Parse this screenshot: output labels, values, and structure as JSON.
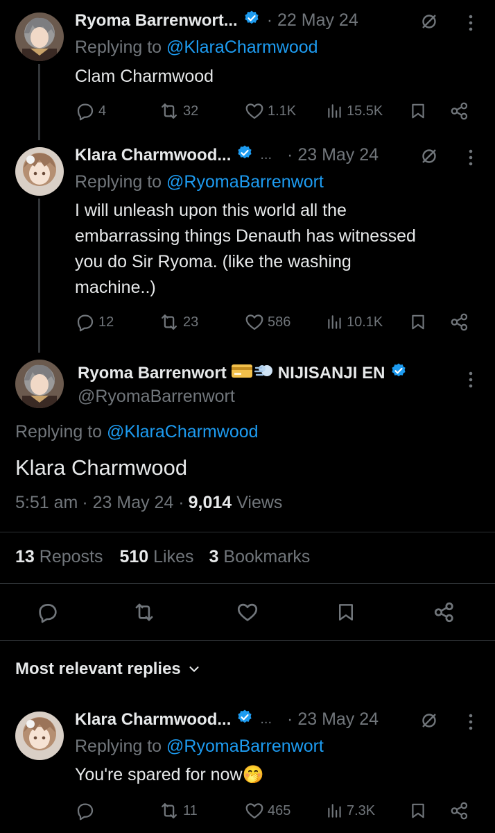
{
  "tweets": [
    {
      "name": "Ryoma Barrenwort...",
      "date": "· 22 May 24",
      "replying_label": "Replying to",
      "replying_handle": "@KlaraCharmwood",
      "text": "Clam Charmwood",
      "replies": "4",
      "reposts": "32",
      "likes": "1.1K",
      "views": "15.5K"
    },
    {
      "name": "Klara Charmwood...",
      "extra": "...",
      "date": "· 23 May 24",
      "replying_label": "Replying to",
      "replying_handle": "@RyomaBarrenwort",
      "text_lines": [
        "I will unleash upon this world all the",
        "embarrassing things Denauth has witnessed",
        "you do Sir Ryoma. (like the washing",
        "machine..)"
      ],
      "replies": "12",
      "reposts": "23",
      "likes": "586",
      "views": "10.1K"
    }
  ],
  "main": {
    "name": "Ryoma Barrenwort",
    "name_suffix": "NIJISANJI EN",
    "handle": "@RyomaBarrenwort",
    "replying_label": "Replying to",
    "replying_handle": "@KlaraCharmwood",
    "text": "Klara Charmwood",
    "time": "5:51 am",
    "date": "· 23 May 24 ·",
    "views_count": "9,014",
    "views_label": "Views",
    "reposts_count": "13",
    "reposts_label": "Reposts",
    "likes_count": "510",
    "likes_label": "Likes",
    "bookmarks_count": "3",
    "bookmarks_label": "Bookmarks"
  },
  "section_title": "Most relevant replies",
  "reply": {
    "name": "Klara Charmwood...",
    "extra": "...",
    "date": "· 23 May 24",
    "replying_label": "Replying to",
    "replying_handle": "@RyomaBarrenwort",
    "text": "You're spared for now",
    "emoji": "🤭",
    "replies": "",
    "reposts": "11",
    "likes": "465",
    "views": "7.3K"
  },
  "colors": {
    "background": "#000000",
    "text": "#e7e9ea",
    "muted": "#71767b",
    "link": "#1d9bf0",
    "verified": "#1d9bf0",
    "divider": "#2f3336"
  }
}
